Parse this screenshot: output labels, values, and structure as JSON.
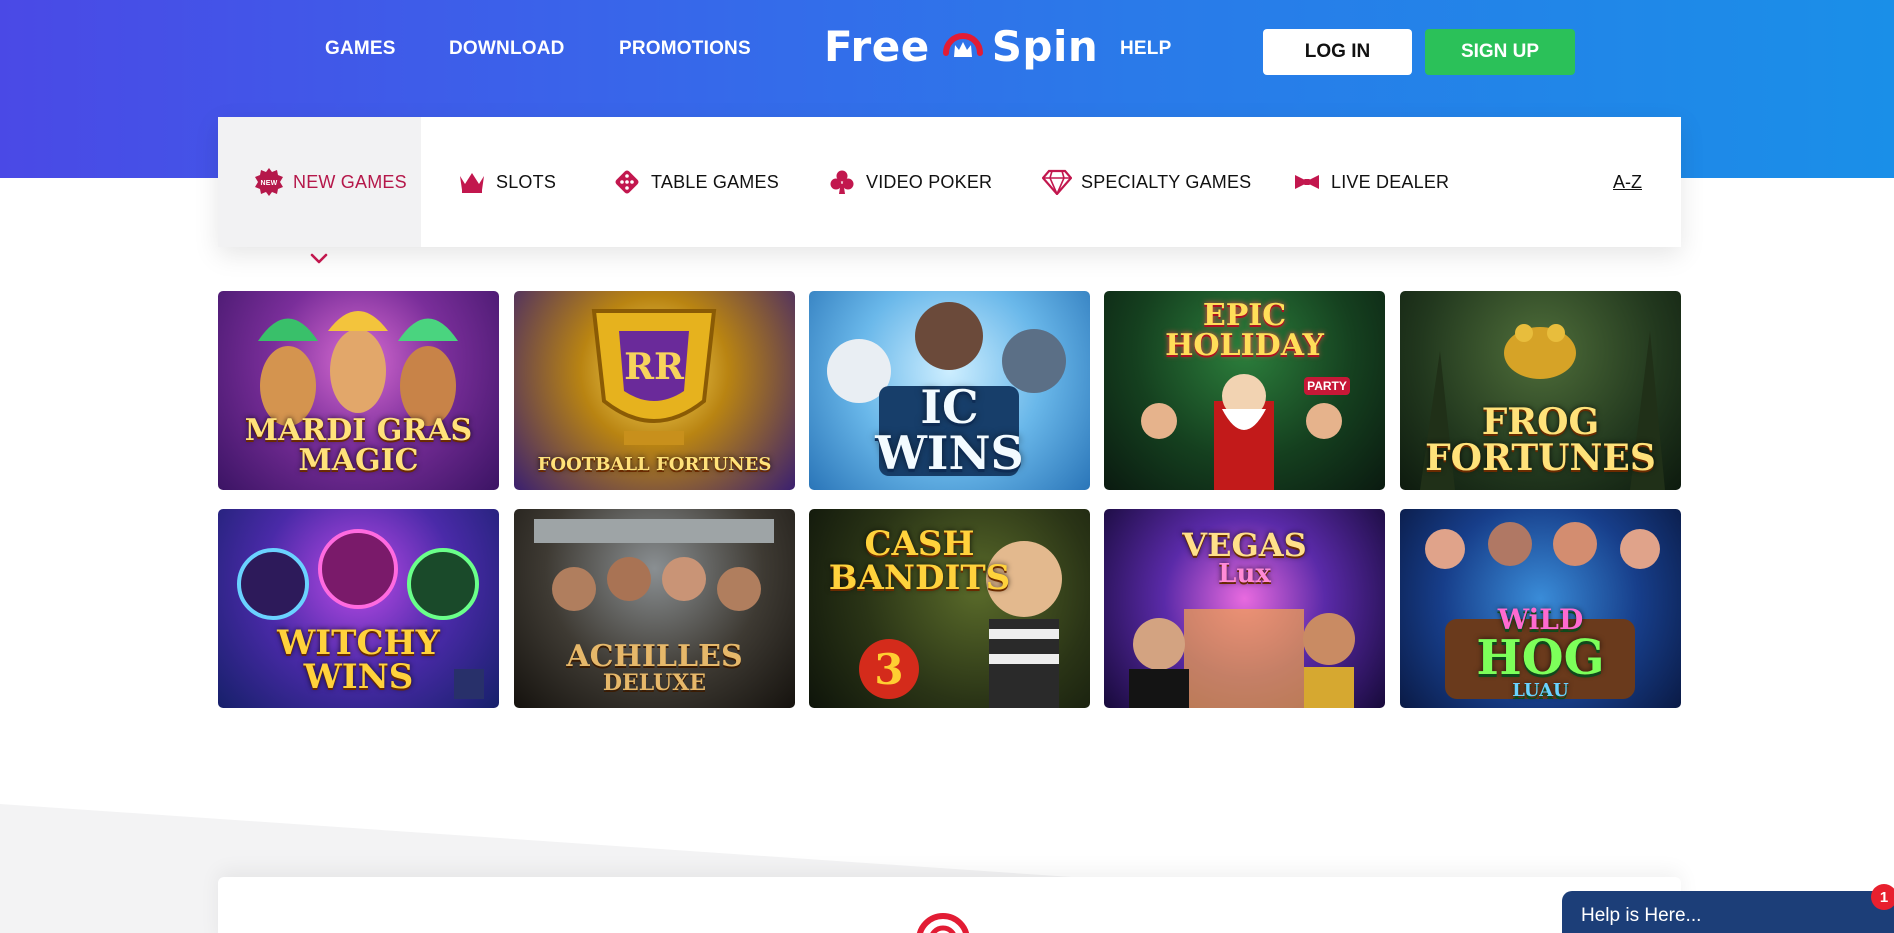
{
  "header": {
    "nav": [
      {
        "label": "GAMES"
      },
      {
        "label": "DOWNLOAD"
      },
      {
        "label": "PROMOTIONS"
      },
      {
        "label": "HELP"
      }
    ],
    "logo": {
      "text_left": "Free",
      "text_right": "Spin"
    },
    "login_label": "LOG IN",
    "signup_label": "SIGN UP"
  },
  "categories": {
    "items": [
      {
        "label": "NEW GAMES",
        "icon": "new-badge-icon",
        "active": true
      },
      {
        "label": "SLOTS",
        "icon": "crown-icon"
      },
      {
        "label": "TABLE GAMES",
        "icon": "dice-icon"
      },
      {
        "label": "VIDEO POKER",
        "icon": "club-icon"
      },
      {
        "label": "SPECIALTY GAMES",
        "icon": "diamond-icon"
      },
      {
        "label": "LIVE DEALER",
        "icon": "bowtie-icon"
      }
    ],
    "az_label": "A-Z",
    "new_badge_text": "NEW"
  },
  "games": [
    {
      "title_line1": "MARDI GRAS",
      "title_line2": "MAGIC"
    },
    {
      "title_line1": "FOOTBALL FORTUNES",
      "title_line2": ""
    },
    {
      "title_line1": "IC",
      "title_line2": "WINS"
    },
    {
      "title_line1": "EPIC",
      "title_line2": "HOLIDAY",
      "badge": "PARTY"
    },
    {
      "title_line1": "FROG",
      "title_line2": "FORTUNES"
    },
    {
      "title_line1": "WITCHY",
      "title_line2": "WINS"
    },
    {
      "title_line1": "ACHILLES",
      "title_line2": "DELUXE"
    },
    {
      "title_line1": "CASH",
      "title_line2": "BANDITS",
      "number": "3"
    },
    {
      "title_line1": "VEGAS",
      "title_line2": "Lux"
    },
    {
      "title_line1": "WiLD",
      "title_line2": "HOG",
      "sub": "LUAU"
    }
  ],
  "help_widget": {
    "label": "Help is Here...",
    "badge": "1"
  },
  "colors": {
    "header_start": "#4a49e6",
    "header_end": "#1a8fe8",
    "signup_green": "#2bc159",
    "accent_red": "#b5184a",
    "help_bg": "#1c3e78",
    "badge_red": "#e8202e"
  }
}
